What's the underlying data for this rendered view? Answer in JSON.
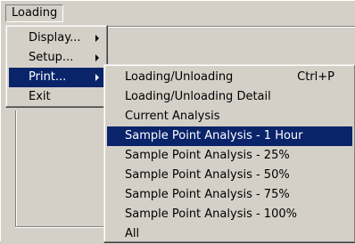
{
  "menubar": {
    "title": "Loading"
  },
  "menu": {
    "items": [
      {
        "label": "Display...",
        "submenu": true
      },
      {
        "label": "Setup...",
        "submenu": true
      },
      {
        "label": "Print...",
        "submenu": true,
        "selected": true
      },
      {
        "label": "Exit",
        "submenu": false
      }
    ]
  },
  "print_submenu": {
    "items": [
      {
        "label": "Loading/Unloading",
        "shortcut": "Ctrl+P"
      },
      {
        "label": "Loading/Unloading Detail"
      },
      {
        "label": "Current Analysis"
      },
      {
        "label": "Sample Point Analysis - 1 Hour",
        "selected": true
      },
      {
        "label": "Sample Point Analysis - 25%"
      },
      {
        "label": "Sample Point Analysis - 50%"
      },
      {
        "label": "Sample Point Analysis - 75%"
      },
      {
        "label": "Sample Point Analysis - 100%"
      },
      {
        "label": "All"
      }
    ]
  },
  "colors": {
    "background": "#d4d0c8",
    "highlight": "#0a246a",
    "highlight_text": "#ffffff"
  }
}
